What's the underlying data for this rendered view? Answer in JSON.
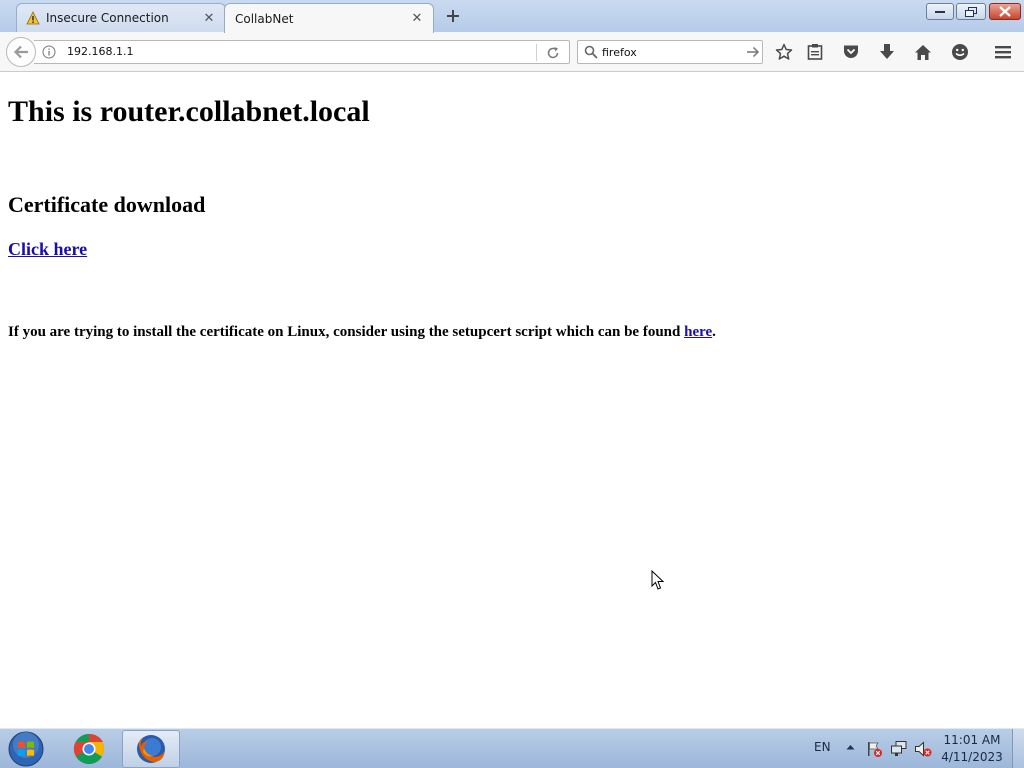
{
  "tabs": [
    {
      "label": "Insecure Connection",
      "icon": "warning-icon",
      "active": false
    },
    {
      "label": "CollabNet",
      "icon": null,
      "active": true
    }
  ],
  "navbar": {
    "url": "192.168.1.1",
    "search_value": "firefox"
  },
  "page": {
    "title": "This is router.collabnet.local",
    "cert_heading": "Certificate download",
    "click_here": "Click here",
    "linux_note_prefix": "If you are trying to install the certificate on Linux, consider using the setupcert script which can be found ",
    "linux_note_link": "here",
    "linux_note_suffix": "."
  },
  "taskbar": {
    "apps": [
      "chrome-icon",
      "firefox-icon"
    ],
    "language": "EN",
    "time": "11:01 AM",
    "date": "4/11/2023"
  },
  "colors": {
    "link": "#1a0dab",
    "warning": "#f2c23a",
    "close_button": "#c8452f"
  }
}
